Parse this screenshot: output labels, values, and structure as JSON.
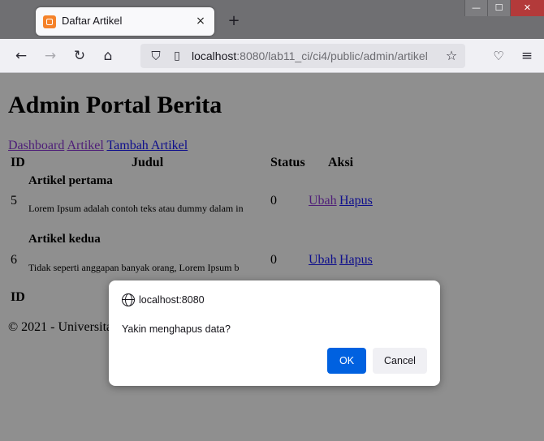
{
  "browser": {
    "tab_title": "Daftar Artikel",
    "tab_close": "×",
    "new_tab": "+",
    "url_host": "localhost",
    "url_rest": ":8080/lab11_ci/ci4/public/admin/artikel",
    "window_controls": [
      "—",
      "☐",
      "✕"
    ]
  },
  "page": {
    "title": "Admin Portal Berita",
    "nav": [
      "Dashboard",
      "Artikel",
      "Tambah Artikel"
    ],
    "table": {
      "headers": [
        "ID",
        "Judul",
        "Status",
        "Aksi"
      ],
      "rows": [
        {
          "id": "5",
          "judul": "Artikel pertama",
          "isi": "Lorem Ipsum adalah contoh teks atau dummy dalam in",
          "status": "0",
          "actions": [
            "Ubah",
            "Hapus"
          ]
        },
        {
          "id": "6",
          "judul": "Artikel kedua",
          "isi": "Tidak seperti anggapan banyak orang, Lorem Ipsum b",
          "status": "0",
          "actions": [
            "Ubah",
            "Hapus"
          ]
        }
      ],
      "footer_header_visible": "ID"
    },
    "footer": "© 2021 - Universitas"
  },
  "dialog": {
    "origin": "localhost:8080",
    "message": "Yakin menghapus data?",
    "ok_label": "OK",
    "cancel_label": "Cancel"
  },
  "colors": {
    "ok_button": "#0061e0",
    "overlay": "#8f8f8f",
    "link": "#0e0e8c",
    "visited_link": "#4e1e78"
  }
}
